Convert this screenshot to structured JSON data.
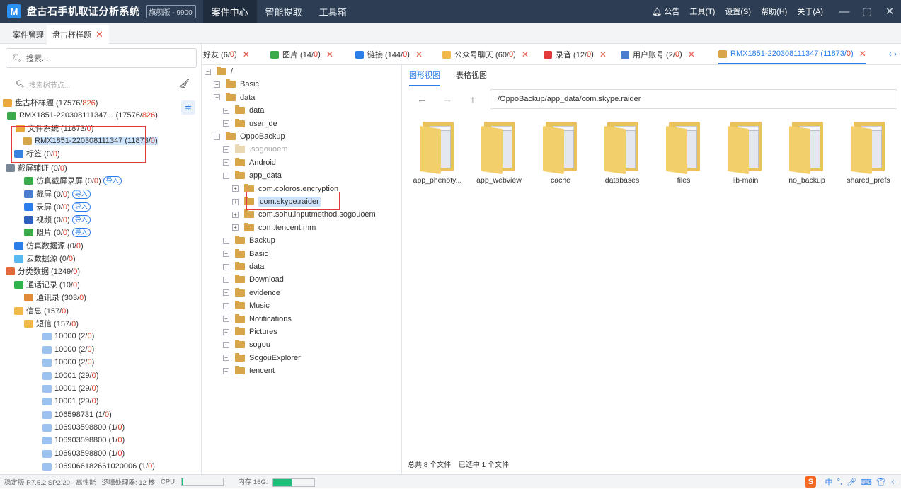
{
  "title_bar": {
    "logo": "M",
    "app_name": "盘古石手机取证分析系统",
    "edition": "旗舰版 - 9900",
    "nav": [
      "案件中心",
      "智能提取",
      "工具箱"
    ],
    "menu": [
      "公告",
      "工具(T)",
      "设置(S)",
      "帮助(H)",
      "关于(A)"
    ]
  },
  "tabs": {
    "items": [
      {
        "label": "案件管理"
      },
      {
        "label": "盘古杯样题"
      }
    ]
  },
  "left_panel": {
    "search_placeholder": "搜索...",
    "tree_search_placeholder": "搜索树节点..."
  },
  "tree": [
    {
      "label": "盘古杯样题 (17576/",
      "red": "826",
      "tail": ")"
    },
    {
      "label": "RMX1851-220308111347... (17576/",
      "red": "826",
      "tail": ")"
    },
    {
      "label": "文件系统 (11873/",
      "red": "0",
      "tail": ")"
    },
    {
      "label": "RMX1851-220308111347 (11873/",
      "red": "0",
      "tail": ")"
    },
    {
      "label": "标签 (0/",
      "red": "0",
      "tail": ")"
    },
    {
      "label": "截屏辅证 (0/",
      "red": "0",
      "tail": ")"
    },
    {
      "label": "仿真截屏录屏 (0/",
      "red": "0",
      "tail": ")",
      "import": "导入"
    },
    {
      "label": "截屏 (0/",
      "red": "0",
      "tail": ")",
      "import": "导入"
    },
    {
      "label": "录屏 (0/",
      "red": "0",
      "tail": ")",
      "import": "导入"
    },
    {
      "label": "视频 (0/",
      "red": "0",
      "tail": ")",
      "import": "导入"
    },
    {
      "label": "照片 (0/",
      "red": "0",
      "tail": ")",
      "import": "导入"
    },
    {
      "label": "仿真数据源 (0/",
      "red": "0",
      "tail": ")"
    },
    {
      "label": "云数据源 (0/",
      "red": "0",
      "tail": ")"
    },
    {
      "label": "分类数据 (1249/",
      "red": "0",
      "tail": ")"
    },
    {
      "label": "通话记录 (10/",
      "red": "0",
      "tail": ")"
    },
    {
      "label": "通讯录 (303/",
      "red": "0",
      "tail": ")"
    },
    {
      "label": "信息 (157/",
      "red": "0",
      "tail": ")"
    },
    {
      "label": "短信 (157/",
      "red": "0",
      "tail": ")"
    },
    {
      "label": "10000 (2/",
      "red": "0",
      "tail": ")"
    },
    {
      "label": "10000 (2/",
      "red": "0",
      "tail": ")"
    },
    {
      "label": "10000 (2/",
      "red": "0",
      "tail": ")"
    },
    {
      "label": "10001 (29/",
      "red": "0",
      "tail": ")"
    },
    {
      "label": "10001 (29/",
      "red": "0",
      "tail": ")"
    },
    {
      "label": "10001 (29/",
      "red": "0",
      "tail": ")"
    },
    {
      "label": "106598731 (1/",
      "red": "0",
      "tail": ")"
    },
    {
      "label": "106903598800 (1/",
      "red": "0",
      "tail": ")"
    },
    {
      "label": "106903598800 (1/",
      "red": "0",
      "tail": ")"
    },
    {
      "label": "106903598800 (1/",
      "red": "0",
      "tail": ")"
    },
    {
      "label": "1069066182661020006 (1/",
      "red": "0",
      "tail": ")"
    }
  ],
  "category_tabs": [
    {
      "label": "好友 (6/",
      "red": "0",
      "tail": ")"
    },
    {
      "label": "图片 (14/",
      "red": "0",
      "tail": ")"
    },
    {
      "label": "链接 (144/",
      "red": "0",
      "tail": ")"
    },
    {
      "label": "公众号聊天 (60/",
      "red": "0",
      "tail": ")"
    },
    {
      "label": "录音 (12/",
      "red": "0",
      "tail": ")"
    },
    {
      "label": "用户账号 (2/",
      "red": "0",
      "tail": ")"
    },
    {
      "label": "RMX1851-220308111347 (11873/",
      "red": "0",
      "tail": ")"
    }
  ],
  "folder_tree": [
    "/",
    "Basic",
    "data",
    "data",
    "user_de",
    "OppoBackup",
    ".sogouoem",
    "Android",
    "app_data",
    "com.coloros.encryption",
    "com.skype.raider",
    "com.sohu.inputmethod.sogouoem",
    "com.tencent.mm",
    "Backup",
    "Basic",
    "data",
    "Download",
    "evidence",
    "Music",
    "Notifications",
    "Pictures",
    "sogou",
    "SogouExplorer",
    "tencent"
  ],
  "right_panel": {
    "view_tabs": [
      "图形视图",
      "表格视图"
    ],
    "path": "/OppoBackup/app_data/com.skype.raider",
    "files": [
      "app_phenoty...",
      "app_webview",
      "cache",
      "databases",
      "files",
      "lib-main",
      "no_backup",
      "shared_prefs"
    ],
    "summary": "总共 8 个文件",
    "selected": "已选中 1 个文件"
  },
  "status": {
    "version": "稳定版 R7.5.2.SP2.20",
    "perf": "高性能",
    "cpu_cores": "逻辑处理器: 12 核",
    "cpu_label": "CPU:",
    "cpu_usage": 0.03,
    "mem_label": "内存 16G:",
    "mem_usage": 0.45
  },
  "colors": {
    "accent": "#2b7de9",
    "titlebar": "#2d3e54",
    "highlight": "#cde3fb",
    "red": "#e03b2a"
  }
}
